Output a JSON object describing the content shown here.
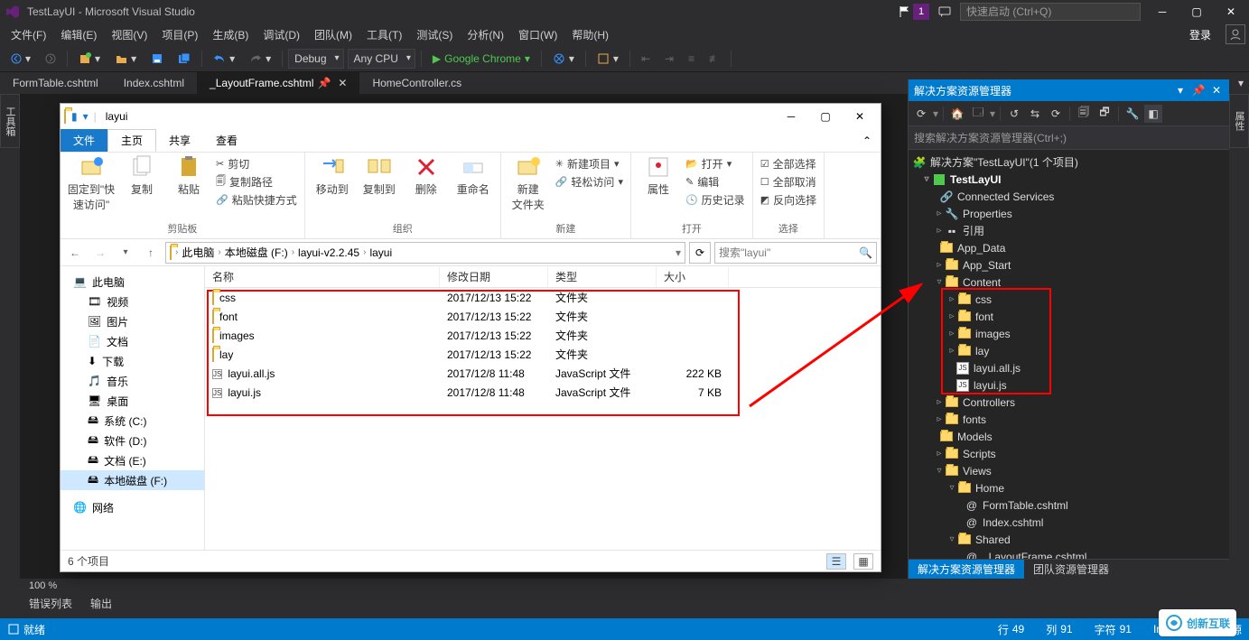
{
  "vs": {
    "title": "TestLayUI - Microsoft Visual Studio",
    "notif_badge": "1",
    "quick_launch_placeholder": "快速启动 (Ctrl+Q)",
    "menubar": [
      "文件(F)",
      "编辑(E)",
      "视图(V)",
      "项目(P)",
      "生成(B)",
      "调试(D)",
      "团队(M)",
      "工具(T)",
      "测试(S)",
      "分析(N)",
      "窗口(W)",
      "帮助(H)"
    ],
    "login": "登录",
    "toolbar": {
      "config": "Debug",
      "platform": "Any CPU",
      "browser": "Google Chrome"
    },
    "side_left": "工具箱",
    "side_right": "属性",
    "tabs": [
      {
        "label": "FormTable.cshtml",
        "active": false
      },
      {
        "label": "Index.cshtml",
        "active": false
      },
      {
        "label": "_LayoutFrame.cshtml",
        "active": true
      },
      {
        "label": "HomeController.cs",
        "active": false
      }
    ],
    "zoom": "100 %",
    "bottom_tabs": [
      "错误列表",
      "输出"
    ],
    "status": {
      "ready": "就绪",
      "line_lbl": "行",
      "line_val": "49",
      "col_lbl": "列",
      "col_val": "91",
      "char_lbl": "字符",
      "char_val": "91",
      "ins": "Ins",
      "add_src": "添加到源"
    }
  },
  "sol": {
    "title": "解决方案资源管理器",
    "search_placeholder": "搜索解决方案资源管理器(Ctrl+;)",
    "solution_text": "解决方案\"TestLayUI\"(1 个项目)",
    "project": "TestLayUI",
    "nodes": {
      "connected_services": "Connected Services",
      "properties": "Properties",
      "references": "引用",
      "app_data": "App_Data",
      "app_start": "App_Start",
      "content": "Content",
      "content_children": [
        "css",
        "font",
        "images",
        "lay",
        "layui.all.js",
        "layui.js"
      ],
      "controllers": "Controllers",
      "fonts": "fonts",
      "models": "Models",
      "scripts": "Scripts",
      "views": "Views",
      "home": "Home",
      "home_children": [
        "FormTable.cshtml",
        "Index.cshtml"
      ],
      "shared": "Shared",
      "shared_children": [
        "_LayoutFrame.cshtml"
      ]
    },
    "btabs": [
      "解决方案资源管理器",
      "团队资源管理器"
    ]
  },
  "explorer": {
    "window_name": "layui",
    "ribbon_tabs": {
      "file": "文件",
      "home": "主页",
      "share": "共享",
      "view": "查看"
    },
    "ribbon": {
      "pin": "固定到\"快\n速访问\"",
      "copy": "复制",
      "paste": "粘贴",
      "cut": "剪切",
      "copypath": "复制路径",
      "pasteshortcut": "粘贴快捷方式",
      "grp_clip": "剪贴板",
      "moveto": "移动到",
      "copyto": "复制到",
      "delete": "删除",
      "rename": "重命名",
      "grp_org": "组织",
      "newfolder": "新建\n文件夹",
      "newitem": "新建项目",
      "easyaccess": "轻松访问",
      "grp_new": "新建",
      "props": "属性",
      "open": "打开",
      "edit": "编辑",
      "history": "历史记录",
      "grp_open": "打开",
      "selall": "全部选择",
      "selnone": "全部取消",
      "selinv": "反向选择",
      "grp_sel": "选择"
    },
    "breadcrumbs": [
      "此电脑",
      "本地磁盘 (F:)",
      "layui-v2.2.45",
      "layui"
    ],
    "search_placeholder": "搜索\"layui\"",
    "nav": {
      "this_pc": "此电脑",
      "items": [
        "视频",
        "图片",
        "文档",
        "下载",
        "音乐",
        "桌面",
        "系统 (C:)",
        "软件 (D:)",
        "文档 (E:)",
        "本地磁盘 (F:)"
      ],
      "network": "网络"
    },
    "cols": {
      "name": "名称",
      "date": "修改日期",
      "type": "类型",
      "size": "大小"
    },
    "rows": [
      {
        "name": "css",
        "date": "2017/12/13 15:22",
        "type": "文件夹",
        "size": ""
      },
      {
        "name": "font",
        "date": "2017/12/13 15:22",
        "type": "文件夹",
        "size": ""
      },
      {
        "name": "images",
        "date": "2017/12/13 15:22",
        "type": "文件夹",
        "size": ""
      },
      {
        "name": "lay",
        "date": "2017/12/13 15:22",
        "type": "文件夹",
        "size": ""
      },
      {
        "name": "layui.all.js",
        "date": "2017/12/8 11:48",
        "type": "JavaScript 文件",
        "size": "222 KB"
      },
      {
        "name": "layui.js",
        "date": "2017/12/8 11:48",
        "type": "JavaScript 文件",
        "size": "7 KB"
      }
    ],
    "status_count": "6 个项目"
  },
  "watermark": "创新互联"
}
